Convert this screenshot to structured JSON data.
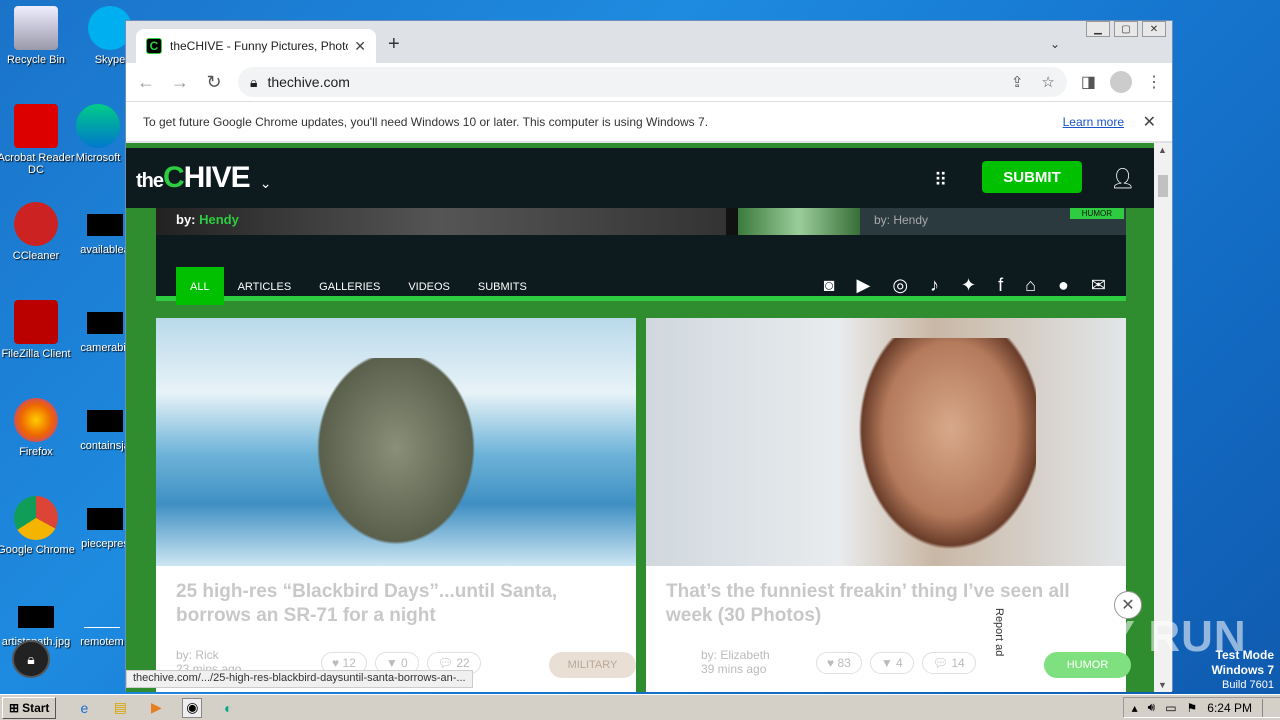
{
  "desktop": {
    "icons": [
      {
        "label": "Recycle Bin",
        "name": "recycle-bin-icon"
      },
      {
        "label": "Skype",
        "name": "skype-icon"
      },
      {
        "label": "Acrobat Reader DC",
        "name": "acrobat-icon"
      },
      {
        "label": "Microsoft",
        "name": "edge-icon"
      },
      {
        "label": "CCleaner",
        "name": "ccleaner-icon"
      },
      {
        "label": "availablea",
        "name": "file-icon"
      },
      {
        "label": "FileZilla Client",
        "name": "filezilla-icon"
      },
      {
        "label": "camerabir",
        "name": "file-icon"
      },
      {
        "label": "Firefox",
        "name": "firefox-icon"
      },
      {
        "label": "containsja",
        "name": "file-icon"
      },
      {
        "label": "Google Chrome",
        "name": "chrome-icon"
      },
      {
        "label": "piecepres",
        "name": "file-icon"
      },
      {
        "label": "artistspath.jpg",
        "name": "image-file-icon"
      },
      {
        "label": "remotem",
        "name": "file-icon"
      }
    ]
  },
  "browser": {
    "tab_title": "theCHIVE - Funny Pictures, Photos,",
    "new_tab": "+",
    "url": "thechive.com",
    "infobar_text": "To get future Google Chrome updates, you'll need Windows 10 or later. This computer is using Windows 7.",
    "infobar_link": "Learn more",
    "status_url": "thechive.com/.../25-high-res-blackbird-daysuntil-santa-borrows-an-..."
  },
  "site": {
    "logo_the": "the",
    "logo_c": "C",
    "logo_rest": "HIVE",
    "submit": "SUBMIT",
    "strip_by_left_prefix": "by:",
    "strip_by_left_name": "Hendy",
    "strip_by_right": "by: Hendy",
    "strip_tag": "HUMOR",
    "categories": [
      "ALL",
      "ARTICLES",
      "GALLERIES",
      "VIDEOS",
      "SUBMITS"
    ],
    "social_icons": [
      "discord-icon",
      "youtube-icon",
      "instagram-icon",
      "tiktok-icon",
      "twitter-icon",
      "facebook-icon",
      "android-icon",
      "apple-icon",
      "mail-icon"
    ],
    "cards": [
      {
        "title": "25 high-res “Blackbird Days”...until Santa, borrows an SR-71 for a night",
        "author": "by: Rick",
        "time": "23 mins ago",
        "likes": "12",
        "dislikes": "0",
        "comments": "22",
        "tag": "MILITARY",
        "tag_color": "#eadfd5"
      },
      {
        "title": "That’s the funniest freakin’ thing I’ve seen all week (30 Photos)",
        "author": "by: Elizabeth",
        "time": "39 mins ago",
        "likes": "83",
        "dislikes": "4",
        "comments": "14",
        "tag": "HUMOR",
        "tag_color": "#7fe07f"
      }
    ],
    "report_ad": "Report ad",
    "accent": "#2ecc40"
  },
  "watermark": "ANY RUN",
  "testmode": {
    "line1": "Test Mode",
    "line2": "Windows 7",
    "line3": "Build 7601"
  },
  "taskbar": {
    "start": "Start",
    "clock": "6:24 PM"
  }
}
